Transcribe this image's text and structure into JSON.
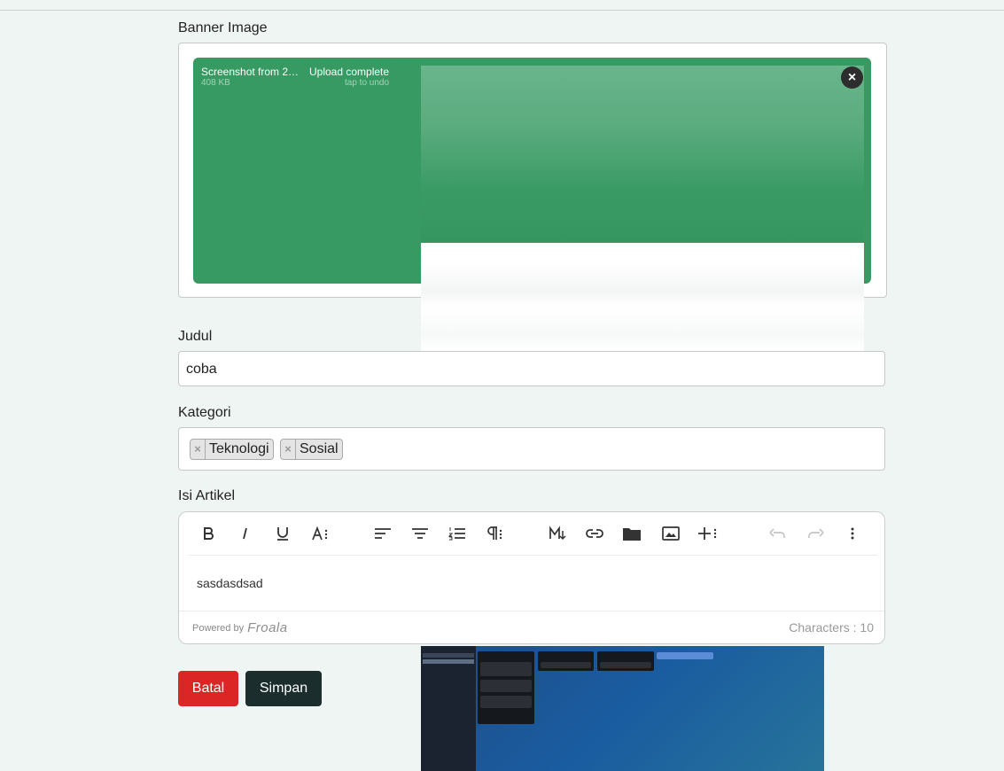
{
  "banner": {
    "label": "Banner Image",
    "file_name": "Screenshot from 2…",
    "file_size": "408 KB",
    "status": "Upload complete",
    "undo_hint": "tap to undo",
    "remove_glyph": "×",
    "panel_color": "#369a62"
  },
  "title_field": {
    "label": "Judul",
    "value": "coba"
  },
  "category_field": {
    "label": "Kategori",
    "tags": [
      {
        "remove_glyph": "×",
        "label": "Teknologi"
      },
      {
        "remove_glyph": "×",
        "label": "Sosial"
      }
    ]
  },
  "editor": {
    "label": "Isi Artikel",
    "content": "sasdasdsad",
    "powered_by": "Powered by",
    "brand": "Froala",
    "char_count": "Characters : 10",
    "toolbar": [
      "bold-icon",
      "italic-icon",
      "underline-icon",
      "font-size-icon",
      "align-left-icon",
      "align-center-icon",
      "ordered-list-icon",
      "paragraph-format-icon",
      "markdown-icon",
      "link-icon",
      "folder-icon",
      "image-icon",
      "more-insert-icon",
      "undo-icon",
      "redo-icon",
      "more-vertical-icon"
    ]
  },
  "actions": {
    "cancel_label": "Batal",
    "save_label": "Simpan",
    "cancel_color": "#dc2626",
    "save_color": "#1c2d2d"
  }
}
